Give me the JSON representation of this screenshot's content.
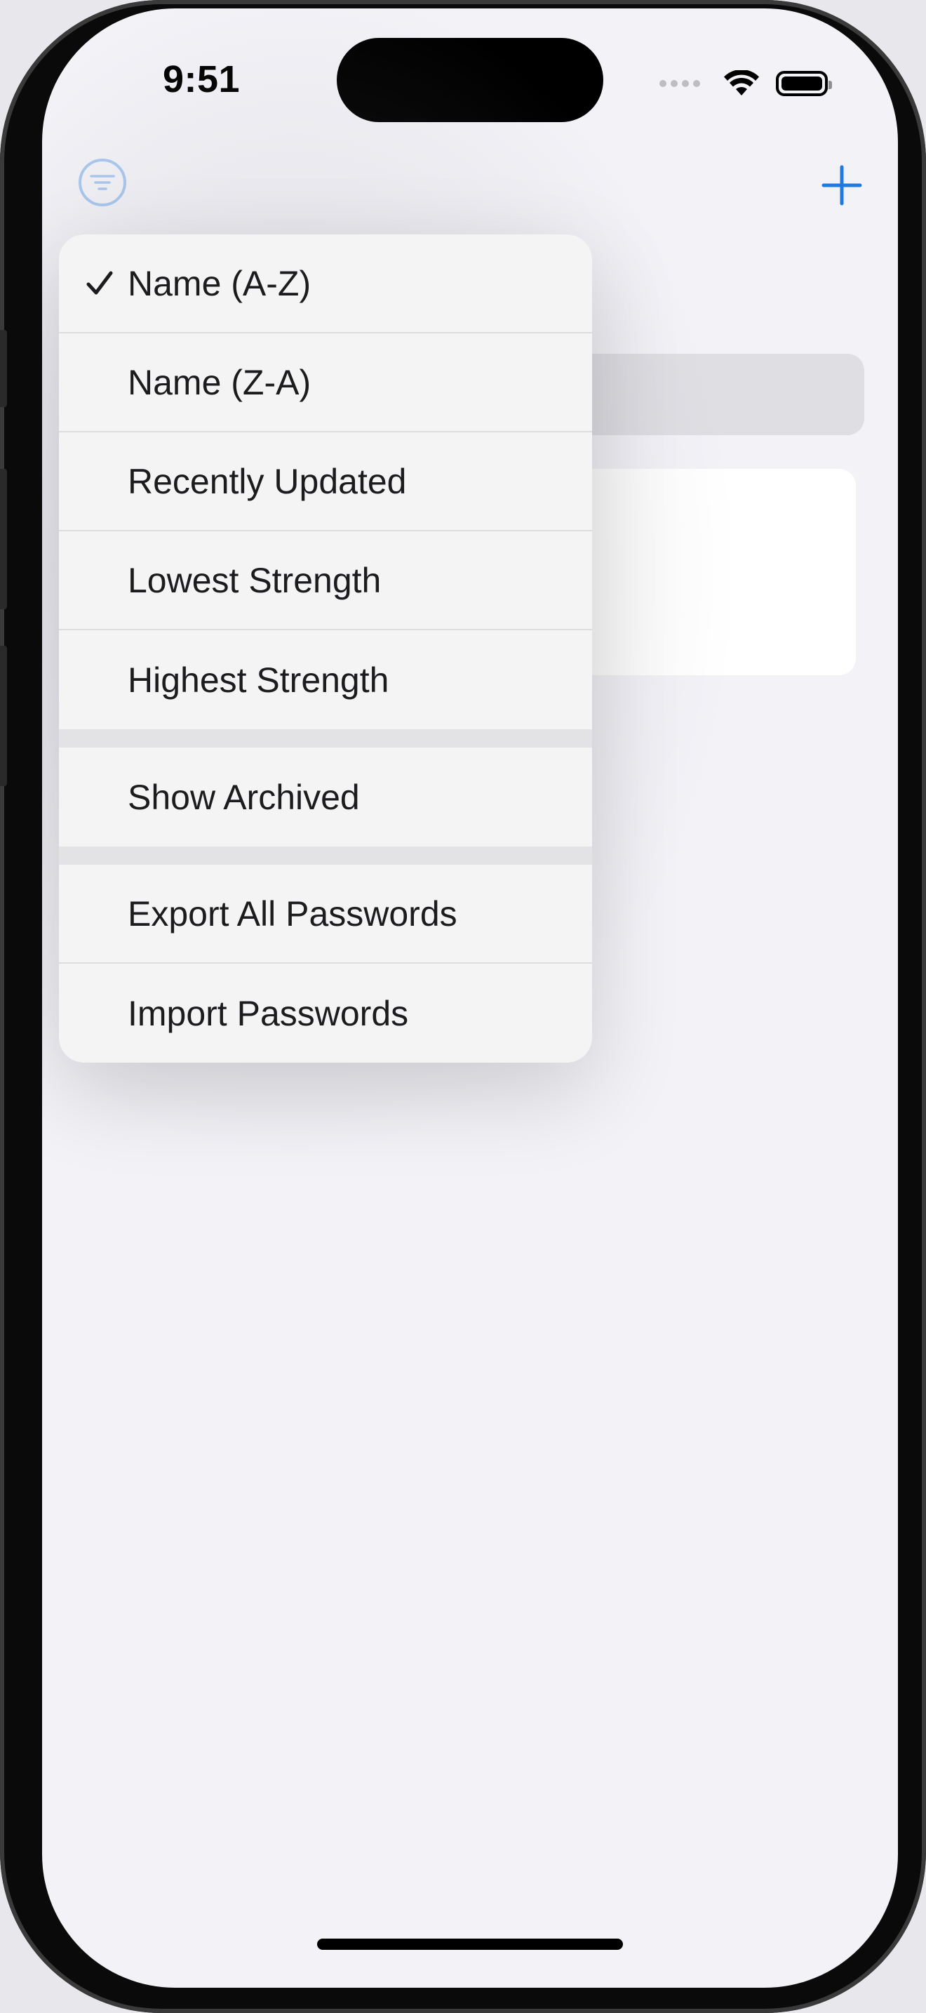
{
  "status_bar": {
    "time": "9:51"
  },
  "nav": {
    "filter_icon": "line-3-horizontal-decrease-circle-icon",
    "add_icon": "plus-icon",
    "accent_color": "#1f7ae0"
  },
  "sort_menu": {
    "groups": [
      {
        "items": [
          {
            "label": "Name (A-Z)",
            "selected": true
          },
          {
            "label": "Name (Z-A)",
            "selected": false
          },
          {
            "label": "Recently Updated",
            "selected": false
          },
          {
            "label": "Lowest Strength",
            "selected": false
          },
          {
            "label": "Highest Strength",
            "selected": false
          }
        ]
      },
      {
        "items": [
          {
            "label": "Show Archived",
            "selected": false
          }
        ]
      },
      {
        "items": [
          {
            "label": "Export All Passwords",
            "selected": false
          },
          {
            "label": "Import Passwords",
            "selected": false
          }
        ]
      }
    ]
  }
}
